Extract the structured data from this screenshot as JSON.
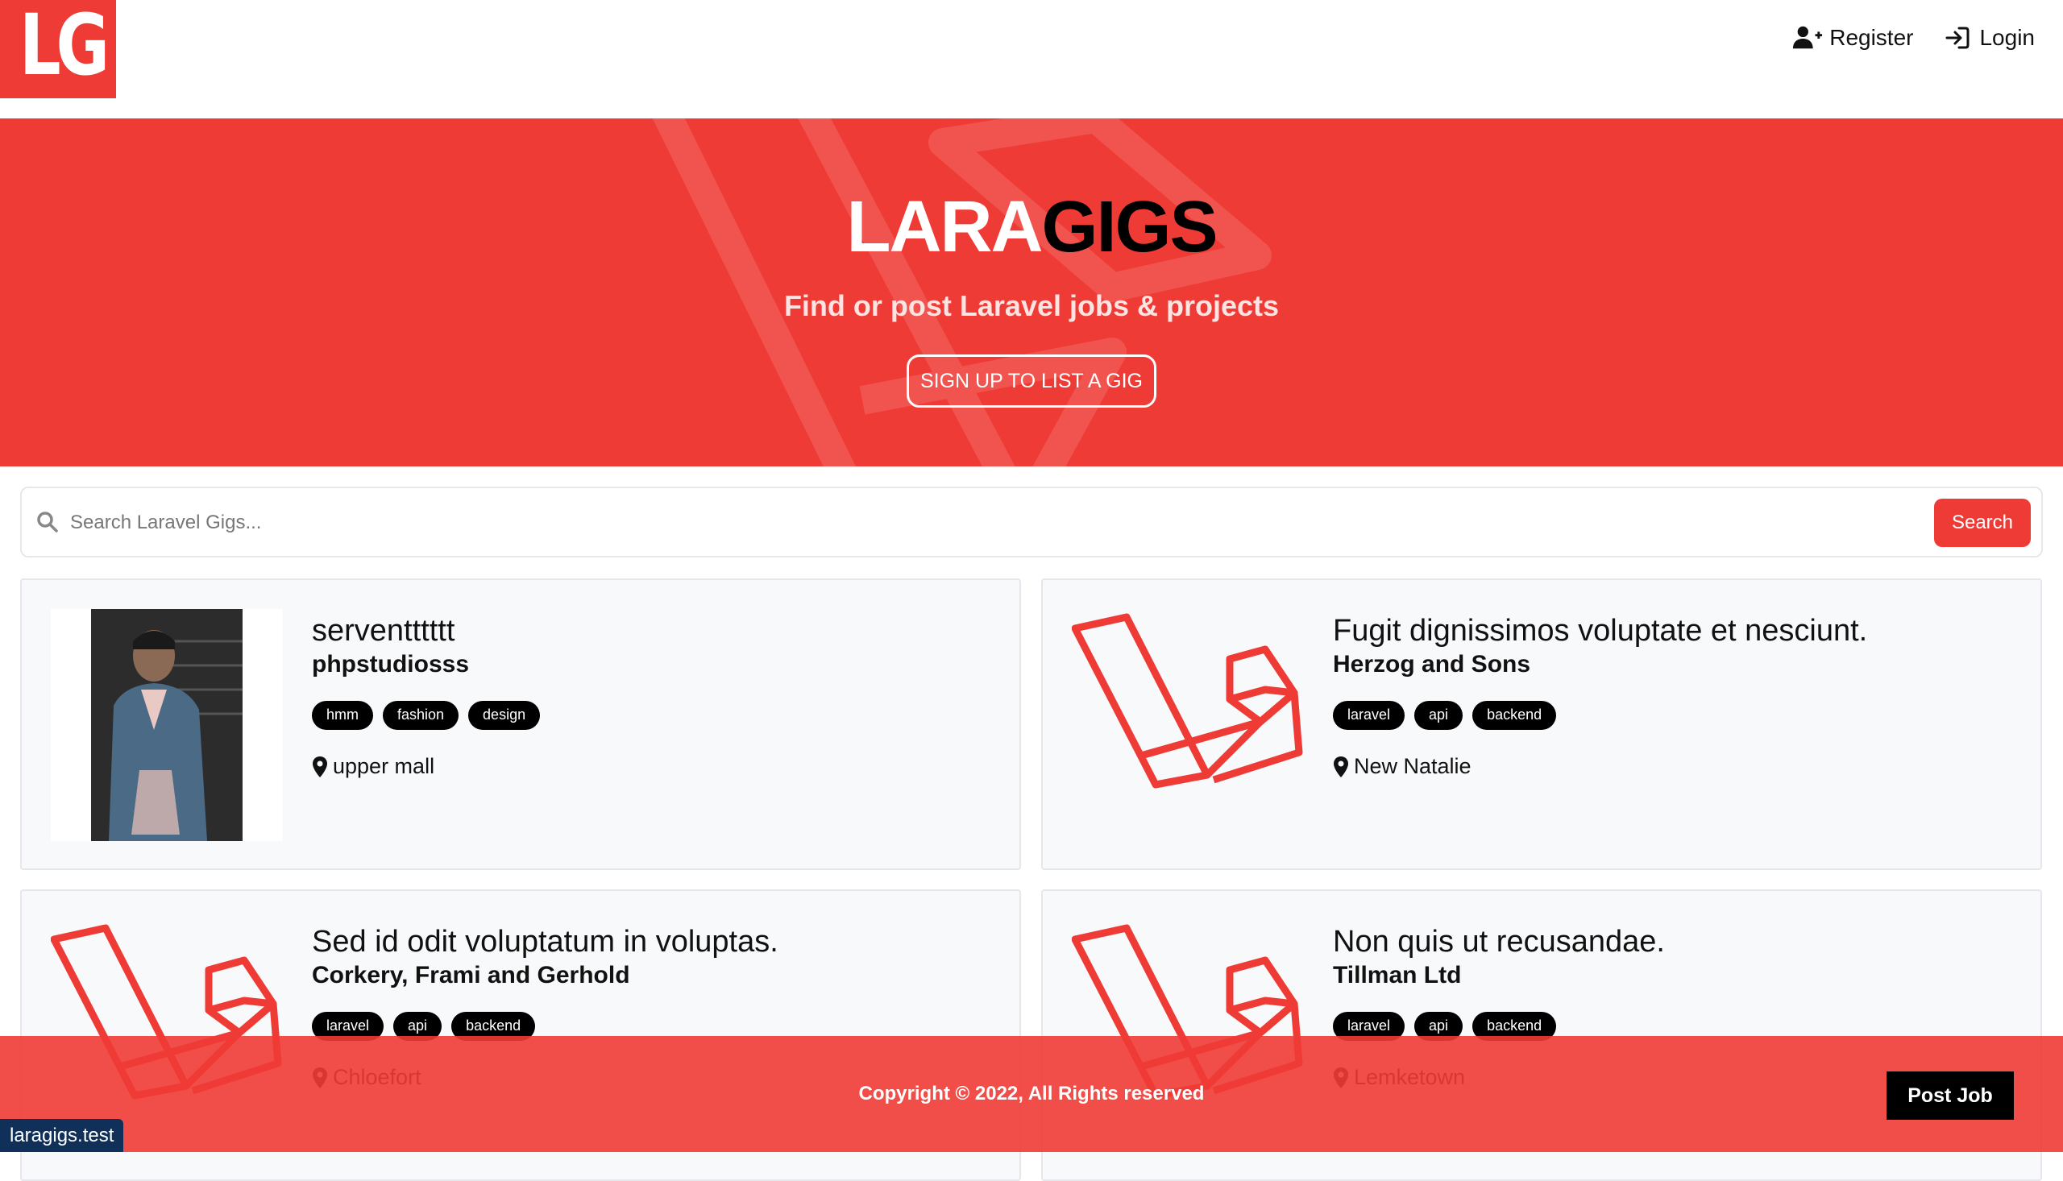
{
  "nav": {
    "logo_text": "LG",
    "register_label": "Register",
    "login_label": "Login"
  },
  "hero": {
    "title_part1": "LARA",
    "title_part2": "GIGS",
    "subtitle": "Find or post Laravel jobs & projects",
    "cta_label": "SIGN UP TO LIST A GIG"
  },
  "search": {
    "placeholder": "Search Laravel Gigs...",
    "button_label": "Search"
  },
  "listings": [
    {
      "title": "serventttttt",
      "company": "phpstudiosss",
      "tags": [
        "hmm",
        "fashion",
        "design"
      ],
      "location": "upper mall",
      "image": "photo"
    },
    {
      "title": "Fugit dignissimos voluptate et nesciunt.",
      "company": "Herzog and Sons",
      "tags": [
        "laravel",
        "api",
        "backend"
      ],
      "location": "New Natalie",
      "image": "laravel-logo"
    },
    {
      "title": "Sed id odit voluptatum in voluptas.",
      "company": "Corkery, Frami and Gerhold",
      "tags": [
        "laravel",
        "api",
        "backend"
      ],
      "location": "Chloefort",
      "image": "laravel-logo"
    },
    {
      "title": "Non quis ut recusandae.",
      "company": "Tillman Ltd",
      "tags": [
        "laravel",
        "api",
        "backend"
      ],
      "location": "Lemketown",
      "image": "laravel-logo"
    }
  ],
  "footer": {
    "copyright": "Copyright © 2022, All Rights reserved",
    "post_job_label": "Post Job"
  },
  "status_bar": {
    "url": "laragigs.test"
  },
  "colors": {
    "brand": "#ef3b36"
  }
}
